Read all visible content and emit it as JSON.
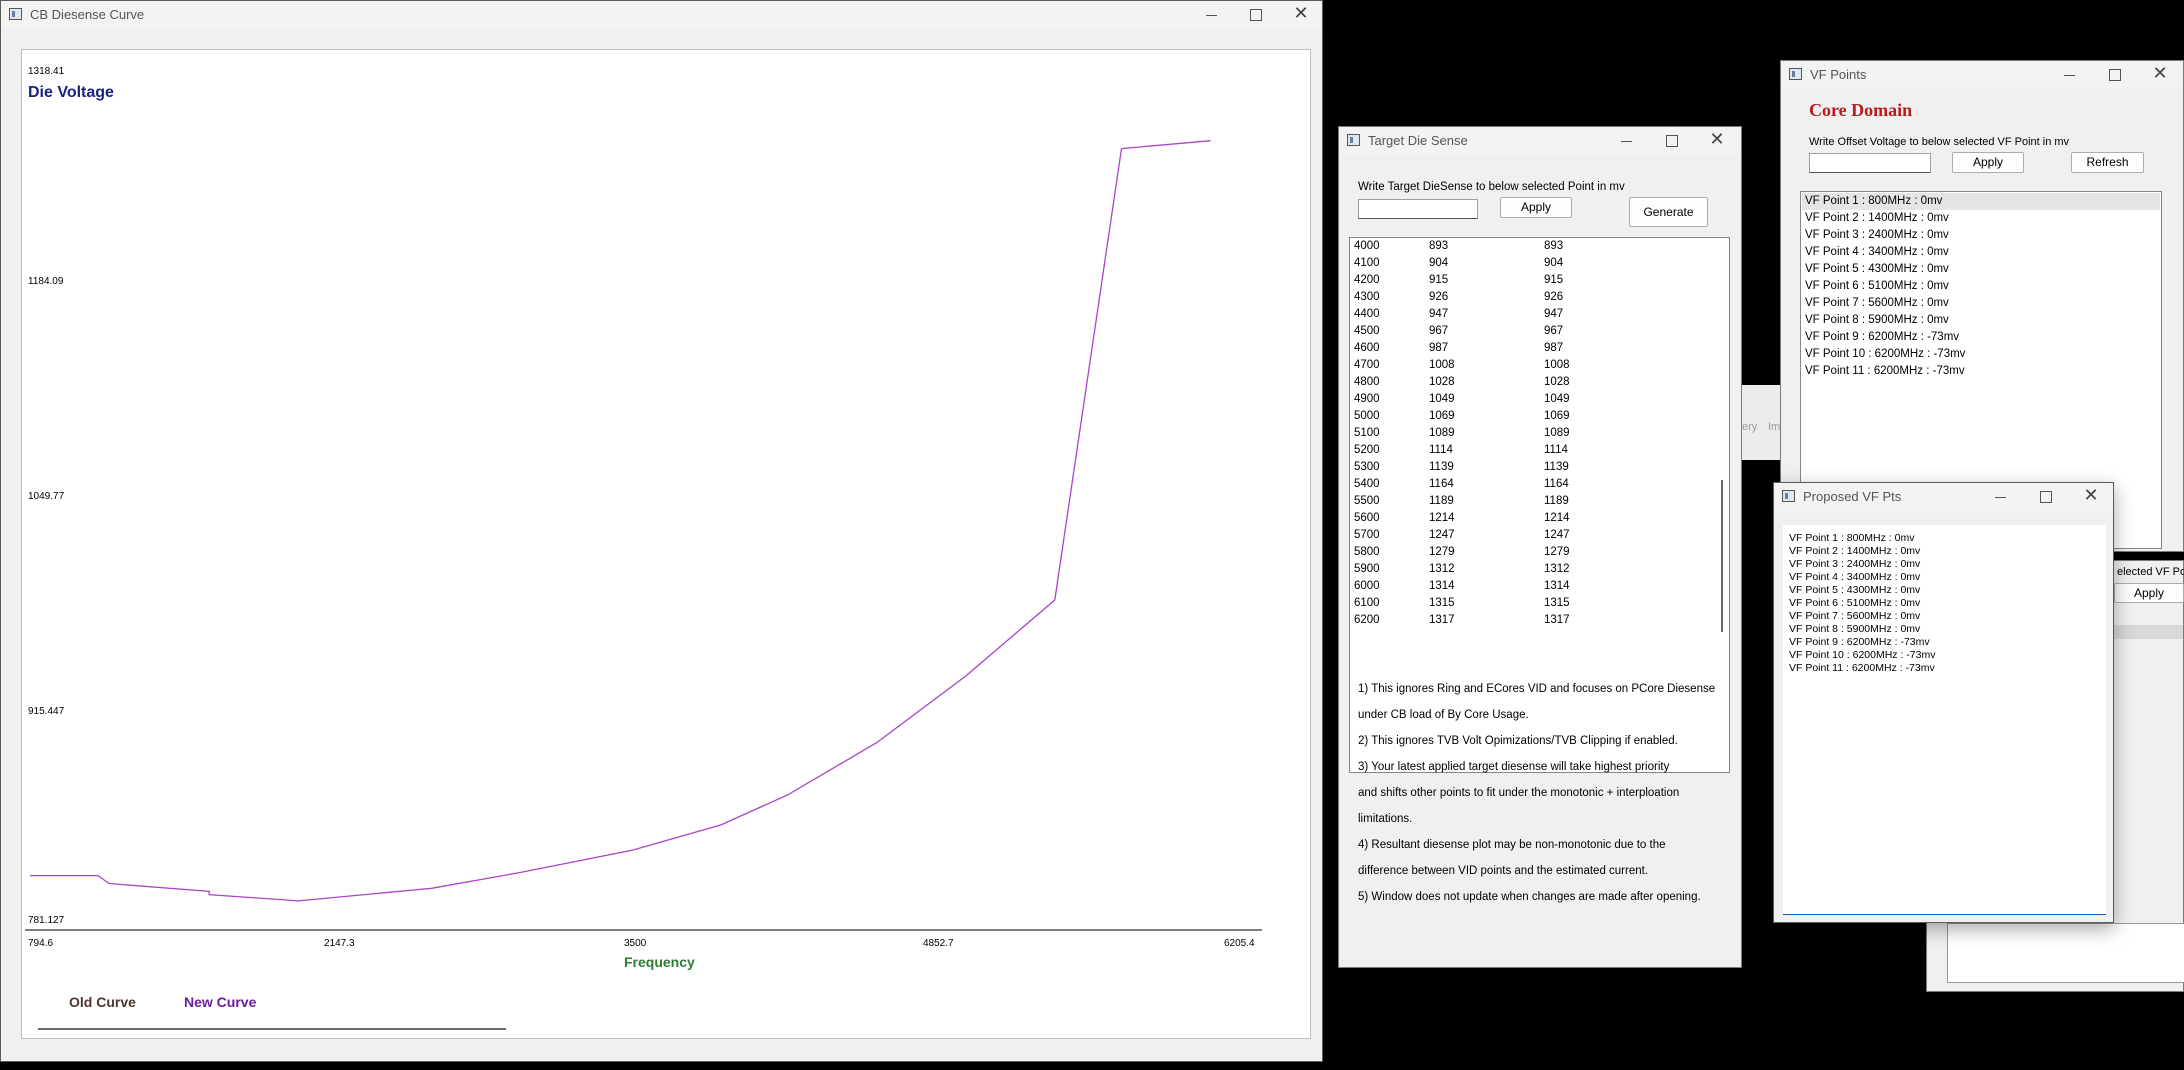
{
  "chart_window": {
    "title": "CB Diesense Curve",
    "y_axis_title": "Die Voltage",
    "x_axis_title": "Frequency",
    "legend": {
      "old": "Old Curve",
      "new": "New Curve"
    },
    "colors": {
      "y_title": "#1a237e",
      "x_title": "#2e7d32",
      "line": "#aa44c8",
      "old_legend": "#4e342e",
      "new_legend": "#6a1b9a"
    }
  },
  "chart_data": {
    "type": "line",
    "y_ticks": [
      "1318.41",
      "1184.09",
      "1049.77",
      "915.447",
      "781.127"
    ],
    "x_ticks": [
      "794.6",
      "2147.3",
      "3500",
      "4852.7",
      "6205.4"
    ],
    "ylim": [
      781.127,
      1318.41
    ],
    "xlim": [
      794.6,
      6205.4
    ],
    "series": [
      {
        "name": "New Curve",
        "x": [
          794.6,
          1100,
          1150,
          1600,
          1600,
          2000,
          2600,
          3000,
          3500,
          3900,
          4200,
          4600,
          5000,
          5400,
          5700,
          6100
        ],
        "y": [
          806,
          806,
          801,
          796,
          794,
          790,
          798,
          808,
          822,
          838,
          857,
          890,
          932,
          980,
          1265,
          1270
        ]
      }
    ]
  },
  "target_window": {
    "title": "Target Die Sense",
    "prompt": "Write Target DieSense to below selected Point in mv",
    "input_value": "",
    "apply_label": "Apply",
    "generate_label": "Generate",
    "rows": [
      [
        "4000",
        "893",
        "893"
      ],
      [
        "4100",
        "904",
        "904"
      ],
      [
        "4200",
        "915",
        "915"
      ],
      [
        "4300",
        "926",
        "926"
      ],
      [
        "4400",
        "947",
        "947"
      ],
      [
        "4500",
        "967",
        "967"
      ],
      [
        "4600",
        "987",
        "987"
      ],
      [
        "4700",
        "1008",
        "1008"
      ],
      [
        "4800",
        "1028",
        "1028"
      ],
      [
        "4900",
        "1049",
        "1049"
      ],
      [
        "5000",
        "1069",
        "1069"
      ],
      [
        "5100",
        "1089",
        "1089"
      ],
      [
        "5200",
        "1114",
        "1114"
      ],
      [
        "5300",
        "1139",
        "1139"
      ],
      [
        "5400",
        "1164",
        "1164"
      ],
      [
        "5500",
        "1189",
        "1189"
      ],
      [
        "5600",
        "1214",
        "1214"
      ],
      [
        "5700",
        "1247",
        "1247"
      ],
      [
        "5800",
        "1279",
        "1279"
      ],
      [
        "5900",
        "1312",
        "1312"
      ],
      [
        "6000",
        "1314",
        "1314"
      ],
      [
        "6100",
        "1315",
        "1315"
      ],
      [
        "6200",
        "1317",
        "1317"
      ]
    ],
    "notes": [
      "1) This ignores Ring and ECores VID and focuses on PCore Diesense",
      "under CB load of By Core Usage.",
      "2) This ignores TVB Volt Opimizations/TVB Clipping if enabled.",
      "3) Your latest applied target diesense will take highest priority",
      "and shifts other points to fit under the monotonic + interploation",
      "limitations.",
      "4) Resultant diesense plot may be non-monotonic due to the",
      "difference between VID points and the estimated current.",
      "5) Window does not update when changes are made after opening."
    ]
  },
  "bg_window": {
    "tab_fragment_1": "ery",
    "tab_fragment_2": "Im",
    "label_fragment": "elected VF Poin",
    "apply_label": "Apply"
  },
  "vf_window": {
    "title": "VF Points",
    "heading": "Core Domain",
    "heading_color": "#b71c1c",
    "prompt": "Write Offset Voltage to below selected VF Point in mv",
    "input_value": "",
    "apply_label": "Apply",
    "refresh_label": "Refresh",
    "items": [
      "VF Point 1 : 800MHz : 0mv",
      "VF Point 2 : 1400MHz : 0mv",
      "VF Point 3 : 2400MHz : 0mv",
      "VF Point 4 : 3400MHz : 0mv",
      "VF Point 5 : 4300MHz : 0mv",
      "VF Point 6 : 5100MHz : 0mv",
      "VF Point 7 : 5600MHz : 0mv",
      "VF Point 8 : 5900MHz : 0mv",
      "VF Point 9 : 6200MHz : -73mv",
      "VF Point 10 : 6200MHz : -73mv",
      "VF Point 11 : 6200MHz : -73mv"
    ]
  },
  "proposed_window": {
    "title": "Proposed VF Pts",
    "items": [
      "VF Point 1 : 800MHz : 0mv",
      "VF Point 2 : 1400MHz : 0mv",
      "VF Point 3 : 2400MHz : 0mv",
      "VF Point 4 : 3400MHz : 0mv",
      "VF Point 5 : 4300MHz : 0mv",
      "VF Point 6 : 5100MHz : 0mv",
      "VF Point 7 : 5600MHz : 0mv",
      "VF Point 8 : 5900MHz : 0mv",
      "VF Point 9 : 6200MHz : -73mv",
      "VF Point 10 : 6200MHz : -73mv",
      "VF Point 11 : 6200MHz : -73mv"
    ]
  }
}
